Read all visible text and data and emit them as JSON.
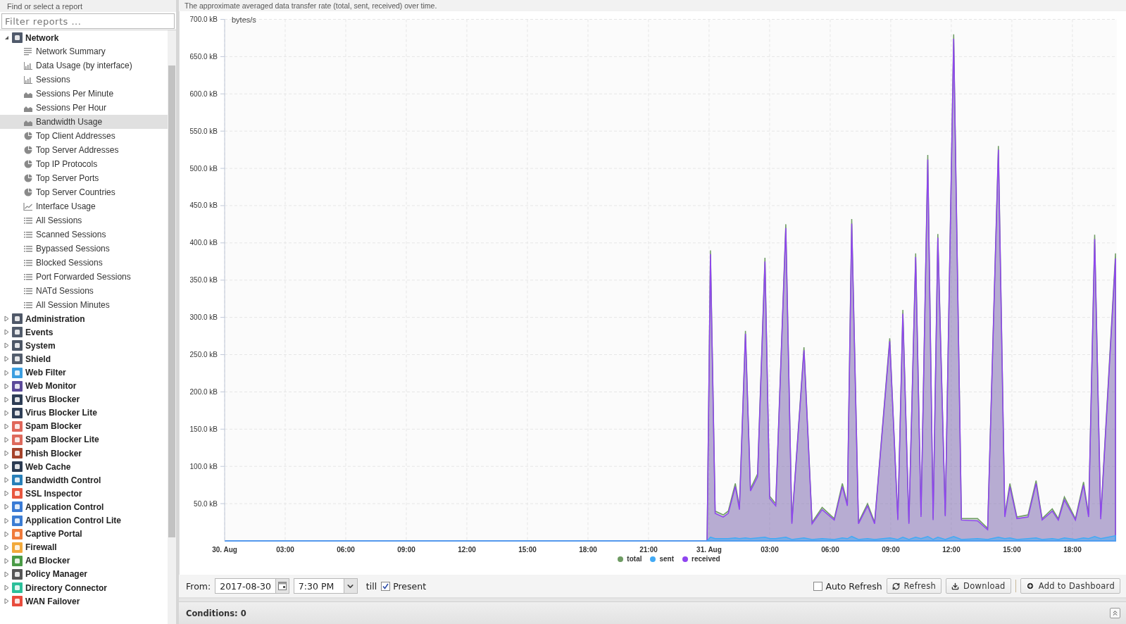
{
  "sidebar": {
    "heading": "Find or select a report",
    "filter": {
      "placeholder": "Filter reports ..."
    },
    "categories": [
      {
        "label": "Network",
        "color": "#505a6b",
        "expanded": true,
        "reports": [
          {
            "label": "Network Summary",
            "kind": "summary",
            "selected": false
          },
          {
            "label": "Data Usage (by interface)",
            "kind": "bar",
            "selected": false
          },
          {
            "label": "Sessions",
            "kind": "bar",
            "selected": false
          },
          {
            "label": "Sessions Per Minute",
            "kind": "area",
            "selected": false
          },
          {
            "label": "Sessions Per Hour",
            "kind": "area",
            "selected": false
          },
          {
            "label": "Bandwidth Usage",
            "kind": "area",
            "selected": true
          },
          {
            "label": "Top Client Addresses",
            "kind": "pie",
            "selected": false
          },
          {
            "label": "Top Server Addresses",
            "kind": "pie",
            "selected": false
          },
          {
            "label": "Top IP Protocols",
            "kind": "pie",
            "selected": false
          },
          {
            "label": "Top Server Ports",
            "kind": "pie",
            "selected": false
          },
          {
            "label": "Top Server Countries",
            "kind": "pie",
            "selected": false
          },
          {
            "label": "Interface Usage",
            "kind": "line",
            "selected": false
          },
          {
            "label": "All Sessions",
            "kind": "list",
            "selected": false
          },
          {
            "label": "Scanned Sessions",
            "kind": "list",
            "selected": false
          },
          {
            "label": "Bypassed Sessions",
            "kind": "list",
            "selected": false
          },
          {
            "label": "Blocked Sessions",
            "kind": "list",
            "selected": false
          },
          {
            "label": "Port Forwarded Sessions",
            "kind": "list",
            "selected": false
          },
          {
            "label": "NATd Sessions",
            "kind": "list",
            "selected": false
          },
          {
            "label": "All Session Minutes",
            "kind": "list",
            "selected": false
          }
        ]
      },
      {
        "label": "Administration",
        "color": "#4f5868",
        "expanded": false
      },
      {
        "label": "Events",
        "color": "#525c6c",
        "expanded": false
      },
      {
        "label": "System",
        "color": "#4d5766",
        "expanded": false
      },
      {
        "label": "Shield",
        "color": "#535d6d",
        "expanded": false
      },
      {
        "label": "Web Filter",
        "color": "#3b9ee0",
        "expanded": false
      },
      {
        "label": "Web Monitor",
        "color": "#5b4a9a",
        "expanded": false
      },
      {
        "label": "Virus Blocker",
        "color": "#2d3d55",
        "expanded": false
      },
      {
        "label": "Virus Blocker Lite",
        "color": "#2f3f57",
        "expanded": false
      },
      {
        "label": "Spam Blocker",
        "color": "#e0675a",
        "expanded": false
      },
      {
        "label": "Spam Blocker Lite",
        "color": "#de6a5c",
        "expanded": false
      },
      {
        "label": "Phish Blocker",
        "color": "#a5422a",
        "expanded": false
      },
      {
        "label": "Web Cache",
        "color": "#2b3b52",
        "expanded": false
      },
      {
        "label": "Bandwidth Control",
        "color": "#2980b9",
        "expanded": false
      },
      {
        "label": "SSL Inspector",
        "color": "#e8563f",
        "expanded": false
      },
      {
        "label": "Application Control",
        "color": "#3a7bd5",
        "expanded": false
      },
      {
        "label": "Application Control Lite",
        "color": "#3c7dd3",
        "expanded": false
      },
      {
        "label": "Captive Portal",
        "color": "#f07a3a",
        "expanded": false
      },
      {
        "label": "Firewall",
        "color": "#f2a93b",
        "expanded": false
      },
      {
        "label": "Ad Blocker",
        "color": "#4a9b46",
        "expanded": false
      },
      {
        "label": "Policy Manager",
        "color": "#565656",
        "expanded": false
      },
      {
        "label": "Directory Connector",
        "color": "#2bbf9a",
        "expanded": false
      },
      {
        "label": "WAN Failover",
        "color": "#e84c3d",
        "expanded": false
      }
    ]
  },
  "report": {
    "description": "The approximate averaged data transfer rate (total, sent, received) over time.",
    "chart_data": {
      "type": "area",
      "ylabel": "bytes/s",
      "grid": true,
      "x": [
        "2017-08-30T00:00",
        "2017-08-30T23:54",
        "2017-08-31T00:04",
        "2017-08-31T00:18",
        "2017-08-31T00:42",
        "2017-08-31T00:57",
        "2017-08-31T01:18",
        "2017-08-31T01:30",
        "2017-08-31T01:48",
        "2017-08-31T02:03",
        "2017-08-31T02:24",
        "2017-08-31T02:46",
        "2017-08-31T03:00",
        "2017-08-31T03:18",
        "2017-08-31T03:48",
        "2017-08-31T04:06",
        "2017-08-31T04:42",
        "2017-08-31T05:06",
        "2017-08-31T05:36",
        "2017-08-31T06:12",
        "2017-08-31T06:36",
        "2017-08-31T06:51",
        "2017-08-31T07:04",
        "2017-08-31T07:24",
        "2017-08-31T07:51",
        "2017-08-31T08:12",
        "2017-08-31T08:57",
        "2017-08-31T09:21",
        "2017-08-31T09:36",
        "2017-08-31T09:54",
        "2017-08-31T10:14",
        "2017-08-31T10:30",
        "2017-08-31T10:50",
        "2017-08-31T11:06",
        "2017-08-31T11:20",
        "2017-08-31T11:42",
        "2017-08-31T12:07",
        "2017-08-31T12:30",
        "2017-08-31T13:18",
        "2017-08-31T13:48",
        "2017-08-31T14:20",
        "2017-08-31T14:39",
        "2017-08-31T14:54",
        "2017-08-31T15:15",
        "2017-08-31T15:48",
        "2017-08-31T16:12",
        "2017-08-31T16:30",
        "2017-08-31T17:00",
        "2017-08-31T17:18",
        "2017-08-31T17:36",
        "2017-08-31T18:09",
        "2017-08-31T18:33",
        "2017-08-31T18:48",
        "2017-08-31T19:06",
        "2017-08-31T19:24",
        "2017-08-31T20:08"
      ],
      "series": [
        {
          "name": "total",
          "color": "#6e9b63",
          "values": [
            0,
            0,
            390,
            40,
            35,
            40,
            77,
            45,
            282,
            70,
            90,
            380,
            60,
            50,
            425,
            25,
            260,
            25,
            45,
            30,
            77,
            50,
            432,
            25,
            50,
            25,
            272,
            30,
            310,
            25,
            386,
            35,
            518,
            30,
            412,
            35,
            680,
            30,
            30,
            17,
            530,
            35,
            77,
            32,
            35,
            81,
            30,
            43,
            30,
            59,
            30,
            79,
            35,
            411,
            32,
            386
          ]
        },
        {
          "name": "sent",
          "color": "#42aaf5",
          "values": [
            0,
            0,
            5,
            3,
            3,
            3,
            4,
            3,
            4,
            3,
            4,
            5,
            3,
            3,
            5,
            2,
            4,
            2,
            3,
            2,
            4,
            3,
            6,
            2,
            3,
            2,
            4,
            2,
            5,
            2,
            5,
            3,
            6,
            2,
            5,
            2,
            6,
            2,
            3,
            2,
            5,
            3,
            4,
            2,
            3,
            4,
            2,
            3,
            2,
            4,
            2,
            4,
            3,
            6,
            3,
            7
          ]
        },
        {
          "name": "received",
          "color": "#8f45f0",
          "values": [
            0,
            0,
            385,
            37,
            32,
            37,
            73,
            42,
            278,
            67,
            86,
            375,
            57,
            47,
            420,
            23,
            256,
            23,
            42,
            28,
            73,
            47,
            426,
            23,
            47,
            23,
            268,
            28,
            305,
            23,
            381,
            32,
            512,
            28,
            407,
            33,
            674,
            28,
            27,
            15,
            525,
            32,
            73,
            30,
            32,
            77,
            28,
            40,
            28,
            55,
            28,
            75,
            32,
            405,
            29,
            379
          ]
        }
      ],
      "xlim": [
        "2017-08-30T00:00",
        "2017-08-31T20:12"
      ],
      "ylim": [
        0,
        700
      ],
      "xticks": [
        {
          "value": "2017-08-30T00:00",
          "label": "30. Aug"
        },
        {
          "value": "2017-08-30T03:00",
          "label": "03:00"
        },
        {
          "value": "2017-08-30T06:00",
          "label": "06:00"
        },
        {
          "value": "2017-08-30T09:00",
          "label": "09:00"
        },
        {
          "value": "2017-08-30T12:00",
          "label": "12:00"
        },
        {
          "value": "2017-08-30T15:00",
          "label": "15:00"
        },
        {
          "value": "2017-08-30T18:00",
          "label": "18:00"
        },
        {
          "value": "2017-08-30T21:00",
          "label": "21:00"
        },
        {
          "value": "2017-08-31T00:00",
          "label": "31. Aug"
        },
        {
          "value": "2017-08-31T03:00",
          "label": "03:00"
        },
        {
          "value": "2017-08-31T06:00",
          "label": "06:00"
        },
        {
          "value": "2017-08-31T09:00",
          "label": "09:00"
        },
        {
          "value": "2017-08-31T12:00",
          "label": "12:00"
        },
        {
          "value": "2017-08-31T15:00",
          "label": "15:00"
        },
        {
          "value": "2017-08-31T18:00",
          "label": "18:00"
        }
      ],
      "yticks": [
        {
          "value": 50,
          "label": "50.0 kB"
        },
        {
          "value": 100,
          "label": "100.0 kB"
        },
        {
          "value": 150,
          "label": "150.0 kB"
        },
        {
          "value": 200,
          "label": "200.0 kB"
        },
        {
          "value": 250,
          "label": "250.0 kB"
        },
        {
          "value": 300,
          "label": "300.0 kB"
        },
        {
          "value": 350,
          "label": "350.0 kB"
        },
        {
          "value": 400,
          "label": "400.0 kB"
        },
        {
          "value": 450,
          "label": "450.0 kB"
        },
        {
          "value": 500,
          "label": "500.0 kB"
        },
        {
          "value": 550,
          "label": "550.0 kB"
        },
        {
          "value": 600,
          "label": "600.0 kB"
        },
        {
          "value": 650,
          "label": "650.0 kB"
        },
        {
          "value": 700,
          "label": "700.0 kB"
        }
      ]
    }
  },
  "toolbar": {
    "from_label": "From:",
    "date": "2017-08-30",
    "time": "7:30 PM",
    "till_label": "till",
    "present": {
      "label": "Present",
      "checked": true
    },
    "auto_refresh": {
      "label": "Auto Refresh",
      "checked": false
    },
    "buttons": [
      {
        "label": "Refresh",
        "kind": "refresh"
      },
      {
        "label": "Download",
        "kind": "download"
      },
      {
        "label": "Add to Dashboard",
        "kind": "add"
      }
    ]
  },
  "conditions": {
    "label": "Conditions: 0"
  }
}
